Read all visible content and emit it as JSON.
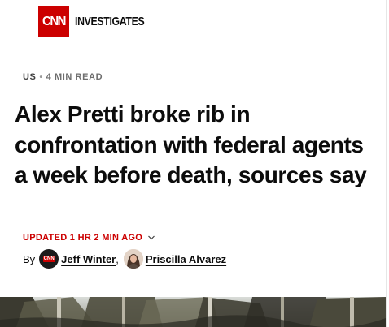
{
  "masthead": {
    "logo_text": "CNN",
    "section_name": "INVESTIGATES"
  },
  "kicker": {
    "category": "US",
    "separator": "•",
    "read_time": "4 MIN READ"
  },
  "headline": "Alex Pretti broke rib in confrontation with federal agents a week before death, sources say",
  "updated": {
    "label": "UPDATED 1 HR 2 MIN AGO"
  },
  "byline": {
    "by_label": "By",
    "authors": [
      {
        "name": "Jeff Winter",
        "avatar": "cnn-logo-avatar"
      },
      {
        "name": "Priscilla Alvarez",
        "avatar": "portrait-photo-avatar"
      }
    ],
    "separator": ","
  },
  "colors": {
    "brand_red": "#cc0000",
    "text": "#0c0c0c",
    "muted": "#6e6e6e",
    "rule": "#e6e6e6"
  },
  "hero_image": {
    "subject": "forest-trees-photo"
  }
}
